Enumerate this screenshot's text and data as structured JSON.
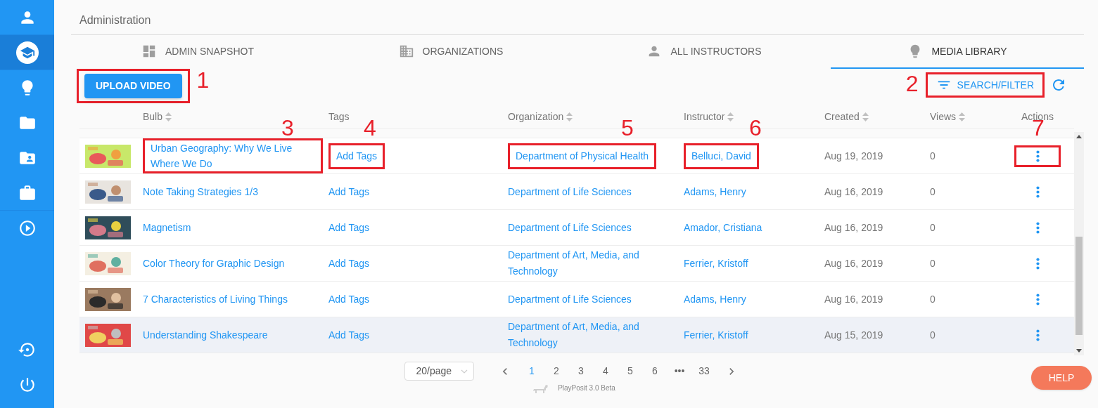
{
  "sidebar": {
    "top_items": [
      {
        "selected": false
      },
      {
        "selected": true
      },
      {
        "selected": false
      },
      {
        "selected": false
      },
      {
        "selected": false
      },
      {
        "selected": false
      },
      {
        "selected": false
      }
    ],
    "bottom_items": [
      {
        "selected": false
      },
      {
        "selected": false
      }
    ]
  },
  "page_title": "Administration",
  "tabs": [
    {
      "label": "ADMIN SNAPSHOT",
      "selected": false
    },
    {
      "label": "ORGANIZATIONS",
      "selected": false
    },
    {
      "label": "ALL INSTRUCTORS",
      "selected": false
    },
    {
      "label": "MEDIA LIBRARY",
      "selected": true
    }
  ],
  "upload_button": {
    "label": "UPLOAD VIDEO",
    "callout": "1"
  },
  "search_filter": {
    "label": "SEARCH/FILTER",
    "callout": "2"
  },
  "table": {
    "columns": [
      {
        "label": "Bulb",
        "sortable": true
      },
      {
        "label": "Tags",
        "sortable": false
      },
      {
        "label": "Organization",
        "sortable": true
      },
      {
        "label": "Instructor",
        "sortable": true
      },
      {
        "label": "Created",
        "sortable": true
      },
      {
        "label": "Views",
        "sortable": true
      },
      {
        "label": "Actions",
        "sortable": false
      }
    ],
    "rows": [
      {
        "bulb": "Urban Geography: Why We Live Where We Do",
        "tags": "Add Tags",
        "organization": "Department of Physical Health",
        "instructor": "Belluci, David",
        "created": "Aug 19, 2019",
        "views": "0",
        "hovered": false,
        "callouts": {
          "bulb": "3",
          "tags": "4",
          "organization": "5",
          "instructor": "6",
          "actions": "7"
        }
      },
      {
        "bulb": "Note Taking Strategies 1/3",
        "tags": "Add Tags",
        "organization": "Department of Life Sciences",
        "instructor": "Adams, Henry",
        "created": "Aug 16, 2019",
        "views": "0",
        "hovered": false
      },
      {
        "bulb": "Magnetism",
        "tags": "Add Tags",
        "organization": "Department of Life Sciences",
        "instructor": "Amador, Cristiana",
        "created": "Aug 16, 2019",
        "views": "0",
        "hovered": false
      },
      {
        "bulb": "Color Theory for Graphic Design",
        "tags": "Add Tags",
        "organization": "Department of Art, Media, and Technology",
        "instructor": "Ferrier, Kristoff",
        "created": "Aug 16, 2019",
        "views": "0",
        "hovered": false
      },
      {
        "bulb": "7 Characteristics of Living Things",
        "tags": "Add Tags",
        "organization": "Department of Life Sciences",
        "instructor": "Adams, Henry",
        "created": "Aug 16, 2019",
        "views": "0",
        "hovered": false
      },
      {
        "bulb": "Understanding Shakespeare",
        "tags": "Add Tags",
        "organization": "Department of Art, Media, and Technology",
        "instructor": "Ferrier, Kristoff",
        "created": "Aug 15, 2019",
        "views": "0",
        "hovered": true
      }
    ]
  },
  "pagination": {
    "page_size": "20/page",
    "pages": [
      {
        "label": "1",
        "selected": true
      },
      {
        "label": "2",
        "selected": false
      },
      {
        "label": "3",
        "selected": false
      },
      {
        "label": "4",
        "selected": false
      },
      {
        "label": "5",
        "selected": false
      },
      {
        "label": "6",
        "selected": false
      },
      {
        "label": "•••",
        "selected": false
      },
      {
        "label": "33",
        "selected": false
      }
    ]
  },
  "footer": "PlayPosit 3.0 Beta",
  "help_button": "HELP"
}
